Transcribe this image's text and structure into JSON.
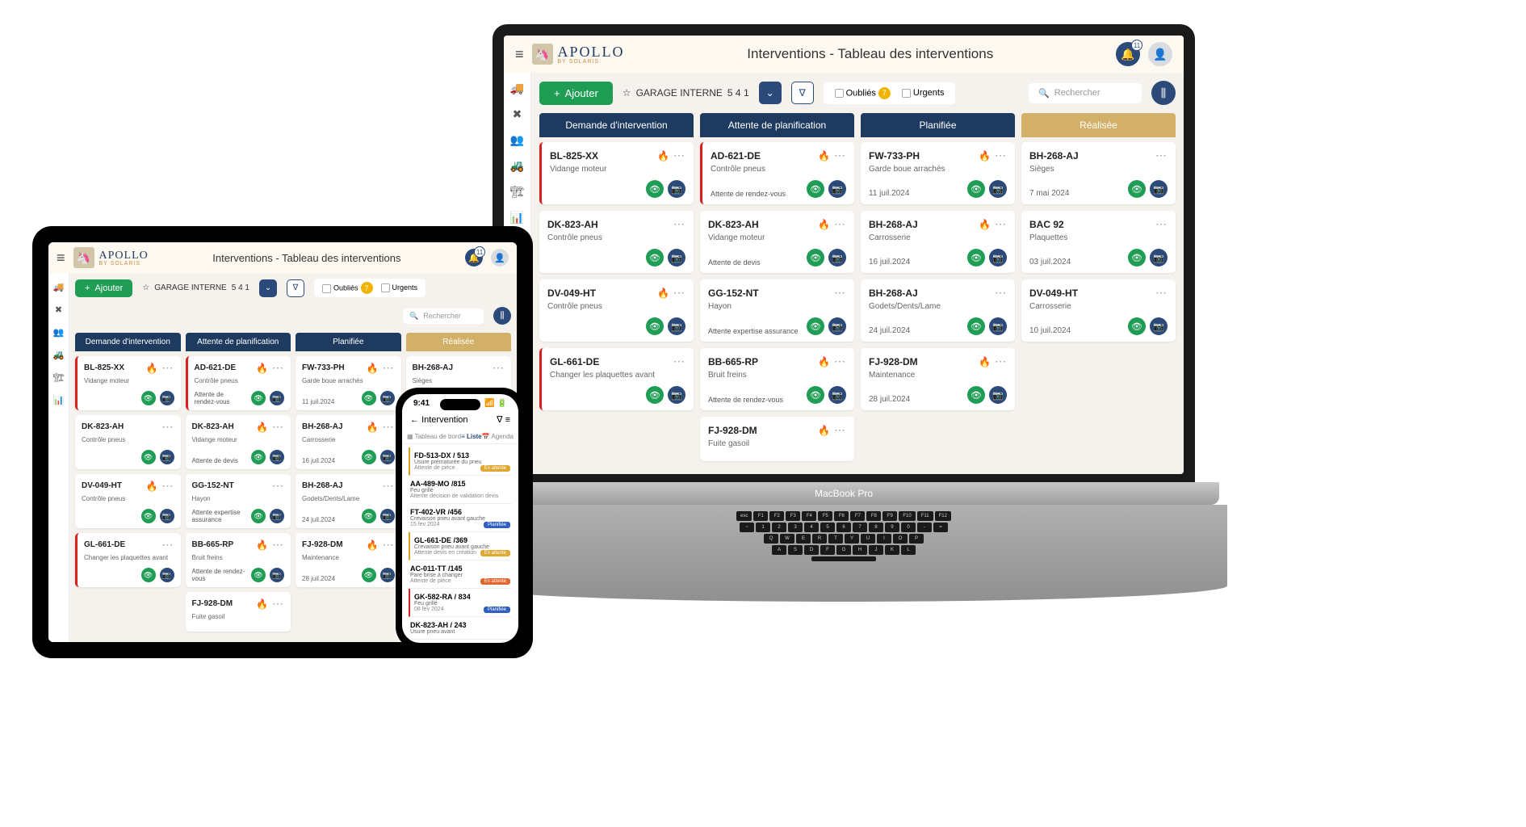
{
  "brand": {
    "name": "APOLLO",
    "tagline": "BY SOLARIS"
  },
  "page_title": "Interventions - Tableau des interventions",
  "notification_count": "11",
  "toolbar": {
    "add_label": "Ajouter",
    "garage_label": "GARAGE INTERNE",
    "garage_count": "5 4 1",
    "oublies_label": "Oubliés",
    "oublies_count": "7",
    "urgents_label": "Urgents",
    "search_placeholder": "Rechercher"
  },
  "columns": [
    {
      "title": "Demande d'intervention",
      "style": "navy"
    },
    {
      "title": "Attente de planification",
      "style": "navy"
    },
    {
      "title": "Planifiée",
      "style": "navy"
    },
    {
      "title": "Réalisée",
      "style": "gold"
    }
  ],
  "laptop_cards": {
    "0": [
      {
        "title": "BL-825-XX",
        "sub": "Vidange moteur",
        "urgent": true,
        "fire": true,
        "btns": true
      },
      {
        "title": "DK-823-AH",
        "sub": "Contrôle pneus",
        "urgent": false,
        "fire": false,
        "btns": true
      },
      {
        "title": "DV-049-HT",
        "sub": "Contrôle pneus",
        "urgent": false,
        "fire": true,
        "btns": true
      },
      {
        "title": "GL-661-DE",
        "sub": "Changer les plaquettes avant",
        "urgent": true,
        "fire": false,
        "btns": true
      }
    ],
    "1": [
      {
        "title": "AD-621-DE",
        "sub": "Contrôle pneus",
        "status": "Attente de rendez-vous",
        "urgent": true,
        "fire": true,
        "btns": true
      },
      {
        "title": "DK-823-AH",
        "sub": "Vidange moteur",
        "status": "Attente de devis",
        "urgent": false,
        "fire": true,
        "btns": true
      },
      {
        "title": "GG-152-NT",
        "sub": "Hayon",
        "status": "Attente expertise assurance",
        "urgent": false,
        "fire": false,
        "btns": true
      },
      {
        "title": "BB-665-RP",
        "sub": "Bruit freins",
        "status": "Attente de rendez-vous",
        "urgent": false,
        "fire": true,
        "btns": true
      },
      {
        "title": "FJ-928-DM",
        "sub": "Fuite gasoil",
        "urgent": false,
        "fire": true,
        "btns": false
      }
    ],
    "2": [
      {
        "title": "FW-733-PH",
        "sub": "Garde boue arrachés",
        "date": "11 juil.2024",
        "urgent": false,
        "fire": true,
        "btns": true
      },
      {
        "title": "BH-268-AJ",
        "sub": "Carrosserie",
        "date": "16 juil.2024",
        "urgent": false,
        "fire": true,
        "btns": true
      },
      {
        "title": "BH-268-AJ",
        "sub": "Godets/Dents/Lame",
        "date": "24 juil.2024",
        "urgent": false,
        "fire": false,
        "btns": true
      },
      {
        "title": "FJ-928-DM",
        "sub": "Maintenance",
        "date": "28 juil.2024",
        "urgent": false,
        "fire": true,
        "btns": true
      }
    ],
    "3": [
      {
        "title": "BH-268-AJ",
        "sub": "Sièges",
        "date": "7 mai 2024",
        "urgent": false,
        "fire": false,
        "btns": true
      },
      {
        "title": "BAC 92",
        "sub": "Plaquettes",
        "date": "03 juil.2024",
        "urgent": false,
        "fire": false,
        "btns": true
      },
      {
        "title": "DV-049-HT",
        "sub": "Carrosserie",
        "date": "10 juil.2024",
        "urgent": false,
        "fire": false,
        "btns": true
      }
    ]
  },
  "sidebar_icons": [
    "truck",
    "wrench",
    "users",
    "tractor",
    "crane",
    "inventory"
  ],
  "phone": {
    "time": "9:41",
    "back_label": "Intervention",
    "tabs": [
      {
        "label": "Tableau de bord",
        "icon": "grid"
      },
      {
        "label": "Liste",
        "icon": "list",
        "active": true
      },
      {
        "label": "Agenda",
        "icon": "cal"
      }
    ],
    "items": [
      {
        "title": "FD-513-DX / 513",
        "sub": "Usure prématurée du pneu",
        "extra": "Attente de pièce",
        "badge": "En attente",
        "color": "yellow",
        "u": "urgent-left"
      },
      {
        "title": "AA-489-MO /815",
        "sub": "Feu grillé",
        "extra": "Attente décision de validation devis",
        "badge": "",
        "u": ""
      },
      {
        "title": "FT-402-VR /456",
        "sub": "Crevaison pneu avant gauche",
        "extra": "15 fev 2024",
        "badge": "Planifiée",
        "color": "blue",
        "u": ""
      },
      {
        "title": "GL-661-DE /369",
        "sub": "Crevaison pneu avant gauche",
        "extra": "Attente devis en création",
        "badge": "En attente",
        "color": "yellow",
        "u": "urgent-left"
      },
      {
        "title": "AC-011-TT /145",
        "sub": "Pare brise à changer",
        "extra": "Attente de pièce",
        "badge": "En attente",
        "color": "orange",
        "u": ""
      },
      {
        "title": "GK-582-RA / 834",
        "sub": "Feu grillé",
        "extra": "08 fev 2024",
        "badge": "Planifiée",
        "color": "blue",
        "u": "red-left"
      },
      {
        "title": "DK-823-AH / 243",
        "sub": "Usure pneu avant",
        "extra": "",
        "badge": "",
        "u": ""
      }
    ]
  },
  "macbook_label": "MacBook Pro"
}
